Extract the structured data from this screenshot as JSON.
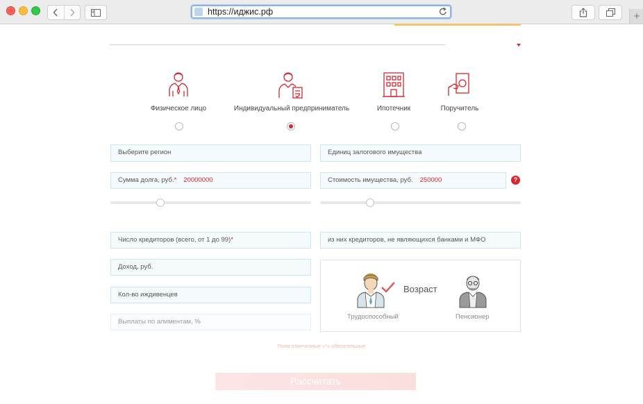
{
  "browser": {
    "url": "https://иджис.рф",
    "new_tab": "+"
  },
  "debtor_types": [
    {
      "label": "Физическое лицо",
      "icon": "person-icon",
      "selected": false
    },
    {
      "label": "Индивидуальный предприниматель",
      "icon": "entrepreneur-icon",
      "selected": true
    },
    {
      "label": "Ипотечник",
      "icon": "building-icon",
      "selected": false
    },
    {
      "label": "Поручитель",
      "icon": "money-hand-icon",
      "selected": false
    }
  ],
  "form": {
    "region_placeholder": "Выберите регион",
    "collateral_placeholder": "Единиц залогового имущества",
    "debt_label": "Сумма долга, руб.",
    "debt_required": "*",
    "debt_value": "20000000",
    "property_label": "Стоимость имущества, руб.",
    "property_value": "250000",
    "help": "?",
    "creditors_label": "Число кредиторов (всего, от 1 до 99)",
    "creditors_required": "*",
    "non_bank_creditors": "из них кредиторов, не являющихся банками и МФО",
    "income": "Доход, руб.",
    "dependents": "Кол-во иждивенцев",
    "alimony": "Выплаты по алиментам, %"
  },
  "sliders": {
    "debt_fraction": 0.25,
    "property_fraction": 0.25
  },
  "age": {
    "title": "Возраст",
    "options": [
      {
        "label": "Трудоспособный",
        "selected": true
      },
      {
        "label": "Пенсионер",
        "selected": false
      }
    ]
  },
  "footer": {
    "note": "Поля отмеченные «*» обязательные",
    "calc_button": "Рассчитать"
  },
  "colors": {
    "accent": "#d8252f",
    "field_bg": "#f5fbfc",
    "field_border": "#cfe6ec"
  }
}
